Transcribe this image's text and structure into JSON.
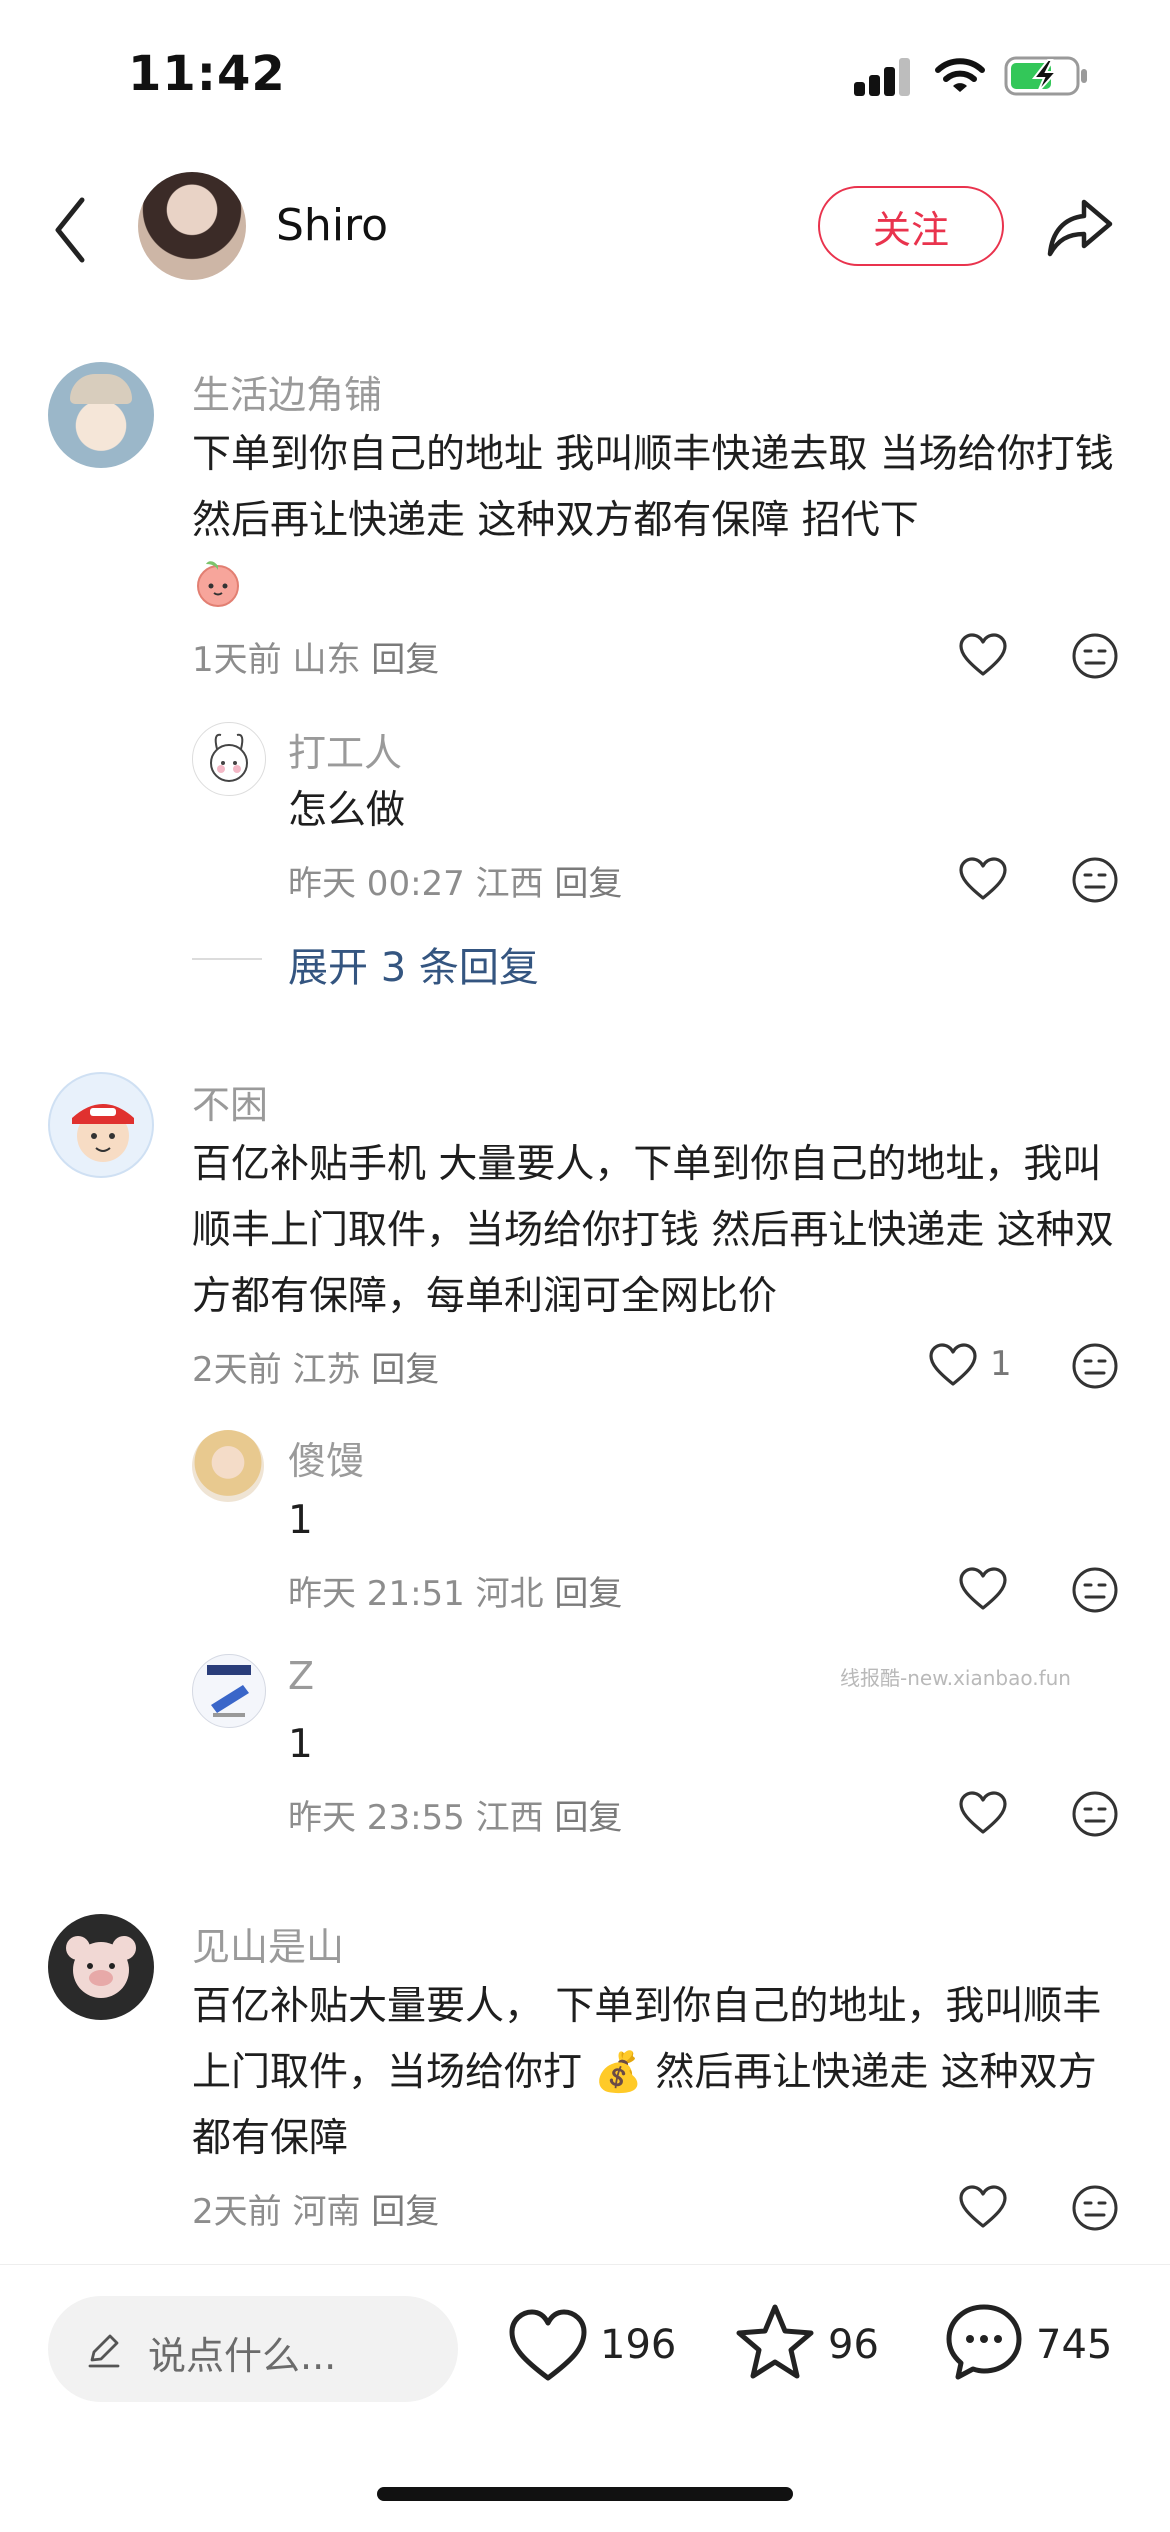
{
  "status_bar": {
    "time": "11:42"
  },
  "header": {
    "username": "Shiro",
    "follow_label": "关注"
  },
  "comments": [
    {
      "username": "生活边角铺",
      "text": "下单到你自己的地址 我叫顺丰快递去取 当场给你打钱 然后再让快递走 这种双方都有保障  招代下",
      "time": "1天前",
      "location": "山东",
      "reply_label": "回复",
      "replies": [
        {
          "username": "打工人",
          "text": "怎么做",
          "time": "昨天 00:27",
          "location": "江西",
          "reply_label": "回复"
        }
      ],
      "expand_label": "展开 3 条回复"
    },
    {
      "username": "不困",
      "text": "百亿补贴手机  大量要人，下单到你自己的地址，我叫顺丰上门取件，当场给你打钱 然后再让快递走 这种双方都有保障，每单利润可全网比价",
      "time": "2天前",
      "location": "江苏",
      "reply_label": "回复",
      "like_count": "1",
      "replies": [
        {
          "username": "傻馒",
          "text": "1",
          "time": "昨天 21:51",
          "location": "河北",
          "reply_label": "回复"
        },
        {
          "username": "Z",
          "text": "1",
          "time": "昨天 23:55",
          "location": "江西",
          "reply_label": "回复"
        }
      ]
    },
    {
      "username": "见山是山",
      "text": "百亿补贴大量要人， 下单到你自己的地址，我叫顺丰上门取件，当场给你打 💰 然后再让快递走 这种双方都有保障",
      "time": "2天前",
      "location": "河南",
      "reply_label": "回复"
    }
  ],
  "watermark": "线报酷-new.xianbao.fun",
  "bottom_bar": {
    "input_placeholder": "说点什么...",
    "like_count": "196",
    "star_count": "96",
    "comment_count": "745"
  },
  "colors": {
    "accent": "#e9334d",
    "link": "#345580"
  },
  "icons": [
    "back-icon",
    "share-icon",
    "heart-icon",
    "meh-face-icon",
    "star-icon",
    "chat-icon",
    "pencil-icon"
  ]
}
